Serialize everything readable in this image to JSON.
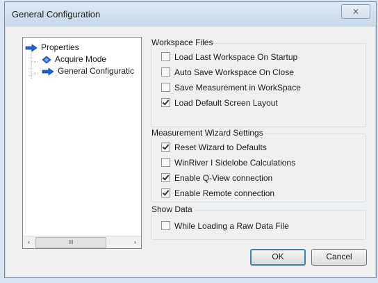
{
  "window": {
    "title": "General Configuration",
    "close_label": "⨯"
  },
  "tree": {
    "items": [
      {
        "label": "Properties",
        "icon": "blue-arrow-icon"
      },
      {
        "label": "Acquire Mode",
        "icon": "blue-diamond-icon"
      },
      {
        "label": "General Configuratic",
        "icon": "blue-arrow-icon"
      }
    ],
    "scroll_left": "‹",
    "scroll_right": "›",
    "scroll_grip": "III"
  },
  "workspace_files": {
    "title": "Workspace Files",
    "options": [
      {
        "label": "Load Last Workspace On Startup",
        "checked": false
      },
      {
        "label": "Auto Save Workspace On Close",
        "checked": false
      },
      {
        "label": "Save Measurement in WorkSpace",
        "checked": false
      },
      {
        "label": "Load Default Screen Layout",
        "checked": true
      }
    ]
  },
  "wizard_settings": {
    "title": "Measurement Wizard Settings",
    "options": [
      {
        "label": "Reset Wizard to Defaults",
        "checked": true
      },
      {
        "label": "WinRiver I Sidelobe Calculations",
        "checked": false
      },
      {
        "label": "Enable Q-View connection",
        "checked": true
      },
      {
        "label": "Enable Remote connection",
        "checked": true
      }
    ]
  },
  "show_data": {
    "title": "Show Data",
    "options": [
      {
        "label": "While Loading a Raw Data File",
        "checked": false
      }
    ]
  },
  "buttons": {
    "ok": "OK",
    "cancel": "Cancel"
  },
  "colors": {
    "tree_arrow": "#1e63d6",
    "titlebar": "#cfdeee"
  }
}
